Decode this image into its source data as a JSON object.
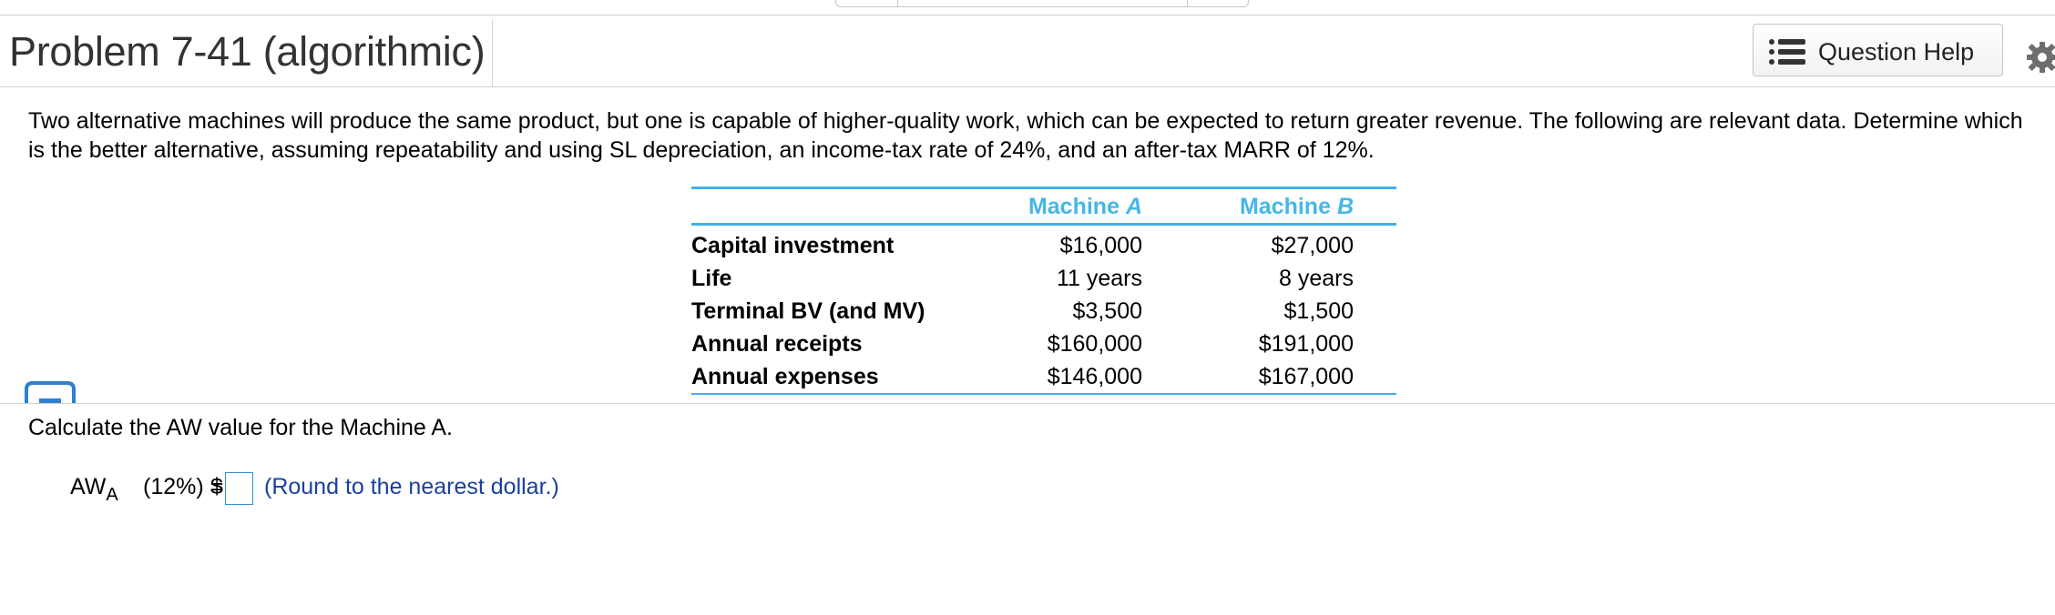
{
  "header": {
    "title": "Problem 7-41 (algorithmic)",
    "help_button_label": "Question Help",
    "help_icon": "list-icon",
    "settings_icon": "gear-icon"
  },
  "problem": {
    "text": "Two alternative machines will produce the same product, but one is capable of higher-quality work, which can be expected to return greater revenue. The following are relevant data. Determine which is the better alternative, assuming repeatability and using SL depreciation, an income-tax rate of 24%, and an after-tax MARR of 12%."
  },
  "table": {
    "col_a_prefix": "Machine ",
    "col_a_letter": "A",
    "col_b_prefix": "Machine ",
    "col_b_letter": "B",
    "rows": [
      {
        "label": "Capital investment",
        "a": "$16,000",
        "b": "$27,000"
      },
      {
        "label": "Life",
        "a": "11 years",
        "b": "8 years"
      },
      {
        "label": "Terminal BV (and MV)",
        "a": "$3,500",
        "b": "$1,500"
      },
      {
        "label": "Annual receipts",
        "a": "$160,000",
        "b": "$191,000"
      },
      {
        "label": "Annual expenses",
        "a": "$146,000",
        "b": "$167,000"
      }
    ]
  },
  "question": {
    "instruction": "Calculate the AW value for the Machine A.",
    "aw_label": "AW",
    "aw_subscript": "A",
    "aw_rate": "(12%) =",
    "currency": "$",
    "answer_value": "",
    "hint": "(Round to the nearest dollar.)"
  },
  "colors": {
    "accent": "#3fb2e8",
    "hint_text": "#1a3f9e",
    "input_border": "#2f8fd6"
  }
}
